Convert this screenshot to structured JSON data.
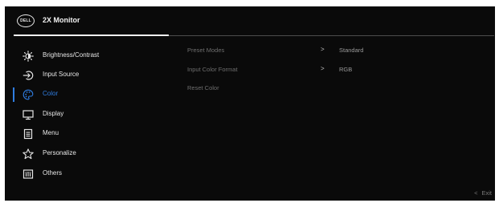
{
  "header": {
    "logo_text": "DELL",
    "title": "2X Monitor"
  },
  "menu": {
    "items": [
      {
        "label": "Brightness/Contrast",
        "icon": "brightness-icon",
        "active": false
      },
      {
        "label": "Input Source",
        "icon": "input-source-icon",
        "active": false
      },
      {
        "label": "Color",
        "icon": "palette-icon",
        "active": true
      },
      {
        "label": "Display",
        "icon": "display-icon",
        "active": false
      },
      {
        "label": "Menu",
        "icon": "menu-icon",
        "active": false
      },
      {
        "label": "Personalize",
        "icon": "star-icon",
        "active": false
      },
      {
        "label": "Others",
        "icon": "others-icon",
        "active": false
      }
    ]
  },
  "submenu": {
    "items": [
      {
        "label": "Preset Modes",
        "chevron": ">",
        "value": "Standard"
      },
      {
        "label": "Input Color Format",
        "chevron": ">",
        "value": "RGB"
      },
      {
        "label": "Reset Color",
        "chevron": "",
        "value": ""
      }
    ]
  },
  "footer": {
    "exit_chevron": "<",
    "exit_label": "Exit"
  },
  "colors": {
    "background": "#0a0a0a",
    "accent": "#2f7de1",
    "text": "#e6e6e6",
    "muted": "#6e6e6e"
  }
}
